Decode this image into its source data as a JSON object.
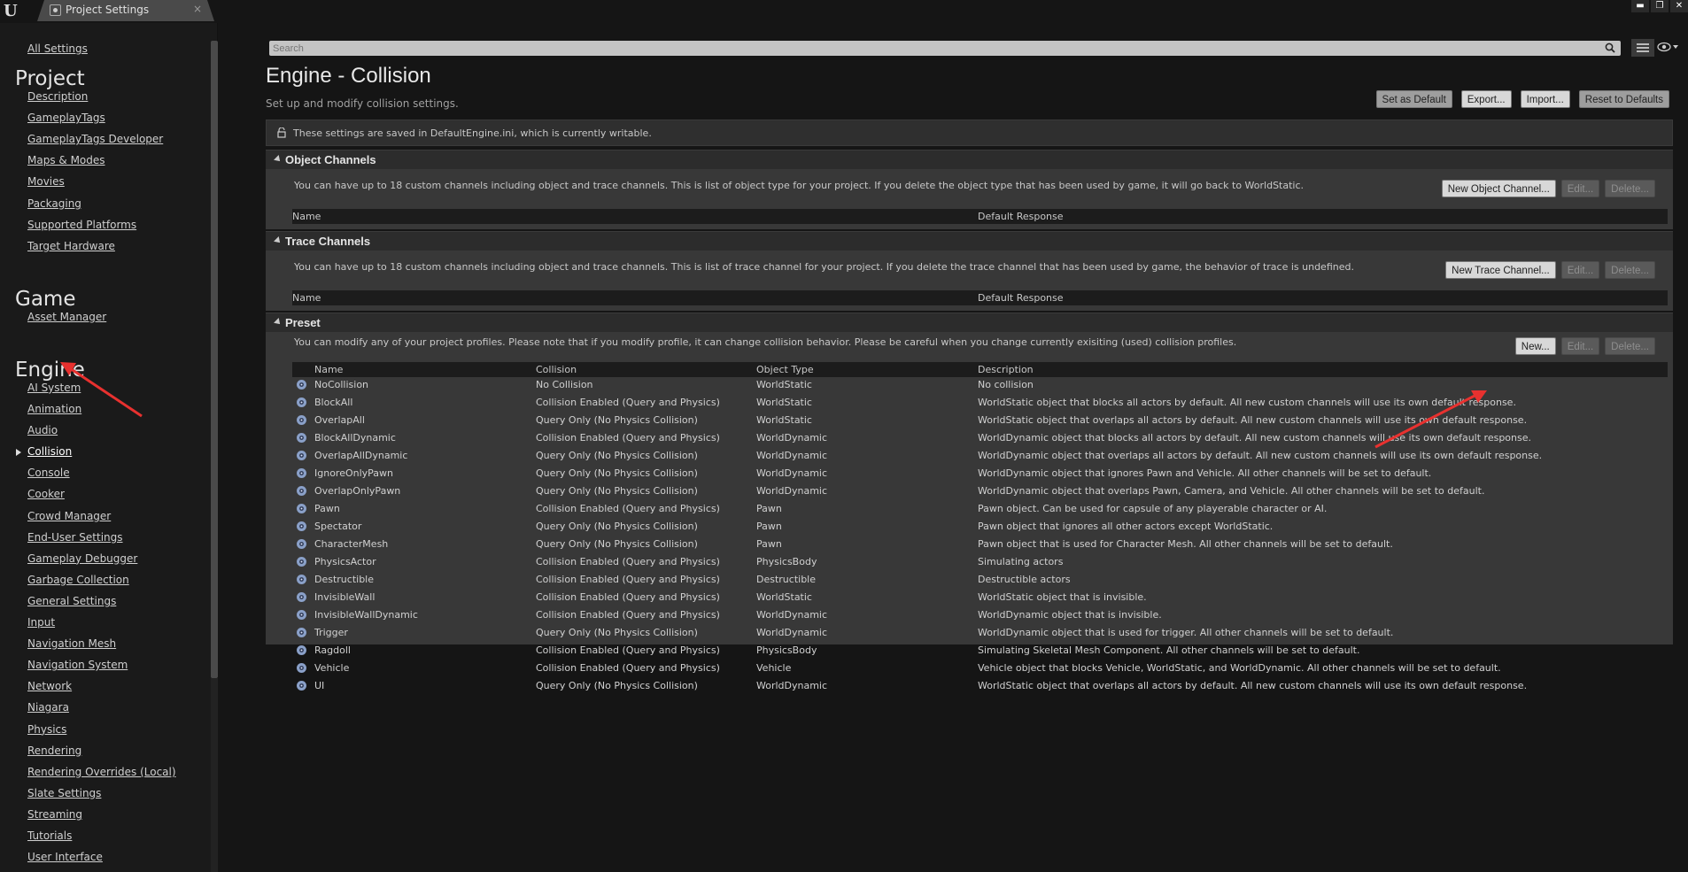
{
  "titlebar": {
    "tab_label": "Project Settings",
    "close_glyph": "×",
    "window_buttons": [
      "▬",
      "❐",
      "✕"
    ]
  },
  "nav": {
    "all_settings": "All Settings",
    "categories": [
      {
        "title": "Project",
        "items": [
          "Description",
          "GameplayTags",
          "GameplayTags Developer",
          "Maps & Modes",
          "Movies",
          "Packaging",
          "Supported Platforms",
          "Target Hardware"
        ]
      },
      {
        "title": "Game",
        "items": [
          "Asset Manager"
        ]
      },
      {
        "title": "Engine",
        "items": [
          "AI System",
          "Animation",
          "Audio",
          "Collision",
          "Console",
          "Cooker",
          "Crowd Manager",
          "End-User Settings",
          "Gameplay Debugger",
          "Garbage Collection",
          "General Settings",
          "Input",
          "Navigation Mesh",
          "Navigation System",
          "Network",
          "Niagara",
          "Physics",
          "Rendering",
          "Rendering Overrides (Local)",
          "Slate Settings",
          "Streaming",
          "Tutorials",
          "User Interface"
        ]
      }
    ],
    "active_item": "Collision"
  },
  "search": {
    "placeholder": "Search"
  },
  "header": {
    "title": "Engine - Collision",
    "subtitle": "Set up and modify collision settings.",
    "actions": [
      "Set as Default",
      "Export...",
      "Import...",
      "Reset to Defaults"
    ]
  },
  "notice": "These settings are saved in DefaultEngine.ini, which is currently writable.",
  "object_channels": {
    "title": "Object Channels",
    "desc": "You can have up to 18 custom channels including object and trace channels. This is list of object type for your project. If you delete the object type that has been used by game, it will go back to WorldStatic.",
    "buttons": [
      "New Object Channel...",
      "Edit...",
      "Delete..."
    ],
    "columns": [
      "Name",
      "Default Response"
    ]
  },
  "trace_channels": {
    "title": "Trace Channels",
    "desc": "You can have up to 18 custom channels including object and trace channels. This is list of trace channel for your project. If you delete the trace channel that has been used by game, the behavior of trace is undefined.",
    "buttons": [
      "New Trace Channel...",
      "Edit...",
      "Delete..."
    ],
    "columns": [
      "Name",
      "Default Response"
    ]
  },
  "preset": {
    "title": "Preset",
    "desc": "You can modify any of your project profiles. Please note that if you modify profile, it can change collision behavior. Please be careful when you change currently exisiting (used) collision profiles.",
    "buttons": [
      "New...",
      "Edit...",
      "Delete..."
    ],
    "columns": [
      "Name",
      "Collision",
      "Object Type",
      "Description"
    ],
    "rows": [
      [
        "NoCollision",
        "No Collision",
        "WorldStatic",
        "No collision"
      ],
      [
        "BlockAll",
        "Collision Enabled (Query and Physics)",
        "WorldStatic",
        "WorldStatic object that blocks all actors by default. All new custom channels will use its own default response."
      ],
      [
        "OverlapAll",
        "Query Only (No Physics Collision)",
        "WorldStatic",
        "WorldStatic object that overlaps all actors by default. All new custom channels will use its own default response."
      ],
      [
        "BlockAllDynamic",
        "Collision Enabled (Query and Physics)",
        "WorldDynamic",
        "WorldDynamic object that blocks all actors by default. All new custom channels will use its own default response."
      ],
      [
        "OverlapAllDynamic",
        "Query Only (No Physics Collision)",
        "WorldDynamic",
        "WorldDynamic object that overlaps all actors by default. All new custom channels will use its own default response."
      ],
      [
        "IgnoreOnlyPawn",
        "Query Only (No Physics Collision)",
        "WorldDynamic",
        "WorldDynamic object that ignores Pawn and Vehicle. All other channels will be set to default."
      ],
      [
        "OverlapOnlyPawn",
        "Query Only (No Physics Collision)",
        "WorldDynamic",
        "WorldDynamic object that overlaps Pawn, Camera, and Vehicle. All other channels will be set to default."
      ],
      [
        "Pawn",
        "Collision Enabled (Query and Physics)",
        "Pawn",
        "Pawn object. Can be used for capsule of any playerable character or AI."
      ],
      [
        "Spectator",
        "Query Only (No Physics Collision)",
        "Pawn",
        "Pawn object that ignores all other actors except WorldStatic."
      ],
      [
        "CharacterMesh",
        "Query Only (No Physics Collision)",
        "Pawn",
        "Pawn object that is used for Character Mesh. All other channels will be set to default."
      ],
      [
        "PhysicsActor",
        "Collision Enabled (Query and Physics)",
        "PhysicsBody",
        "Simulating actors"
      ],
      [
        "Destructible",
        "Collision Enabled (Query and Physics)",
        "Destructible",
        "Destructible actors"
      ],
      [
        "InvisibleWall",
        "Collision Enabled (Query and Physics)",
        "WorldStatic",
        "WorldStatic object that is invisible."
      ],
      [
        "InvisibleWallDynamic",
        "Collision Enabled (Query and Physics)",
        "WorldDynamic",
        "WorldDynamic object that is invisible."
      ],
      [
        "Trigger",
        "Query Only (No Physics Collision)",
        "WorldDynamic",
        "WorldDynamic object that is used for trigger. All other channels will be set to default."
      ],
      [
        "Ragdoll",
        "Collision Enabled (Query and Physics)",
        "PhysicsBody",
        "Simulating Skeletal Mesh Component. All other channels will be set to default."
      ],
      [
        "Vehicle",
        "Collision Enabled (Query and Physics)",
        "Vehicle",
        "Vehicle object that blocks Vehicle, WorldStatic, and WorldDynamic. All other channels will be set to default."
      ],
      [
        "UI",
        "Query Only (No Physics Collision)",
        "WorldDynamic",
        "WorldStatic object that overlaps all actors by default. All new custom channels will use its own default response."
      ]
    ]
  },
  "colors": {
    "annotation_arrow": "#e8312f",
    "panel": "#383838",
    "background": "#151515"
  }
}
